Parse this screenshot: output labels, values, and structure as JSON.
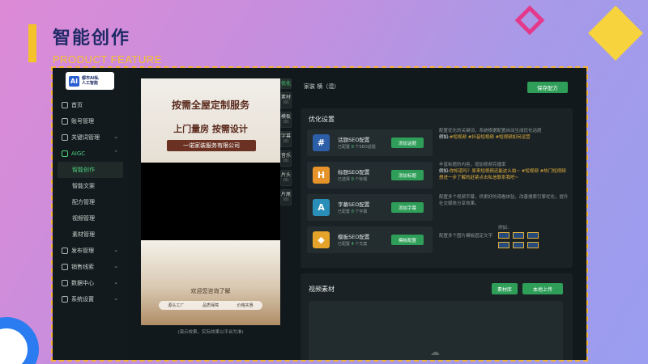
{
  "slide": {
    "title": "智能创作",
    "subtitle": "PRODUCT FEATURE"
  },
  "colors": {
    "accent_green": "#2e9e58",
    "accent_yellow": "#f4c22b",
    "title_blue": "#1f2a66",
    "app_bg": "#12191d"
  },
  "app": {
    "logo": {
      "line1": "都市AI私",
      "line2": "人工智能",
      "mark": "AI"
    },
    "sidebar": {
      "items": [
        {
          "label": "首页",
          "icon": "home-icon"
        },
        {
          "label": "账号管理",
          "icon": "account-icon"
        },
        {
          "label": "关键词管理",
          "icon": "gear-icon",
          "chev": "⌄"
        },
        {
          "label": "AIGC",
          "icon": "aigc-icon",
          "chev": "⌃"
        },
        {
          "label": "发布管理",
          "icon": "publish-icon",
          "chev": "⌄"
        },
        {
          "label": "销售线索",
          "icon": "leads-icon",
          "chev": "⌄"
        },
        {
          "label": "数据中心",
          "icon": "data-icon",
          "chev": "⌄"
        },
        {
          "label": "系统设置",
          "icon": "settings-icon",
          "chev": "⌄"
        }
      ],
      "aigc_sub": [
        "智能创作",
        "智能文案",
        "配方管理",
        "视频管理",
        "素材管理"
      ]
    },
    "phone": {
      "line1": "按需全屋定制服务",
      "line2": "上门量房 按需设计",
      "band": "一诺家装服务有限公司",
      "welcome": "欢迎您咨询了解",
      "tags": [
        "源头工厂",
        "品质保障",
        "价格实惠"
      ],
      "caption": "(演示效果，实际效果以平台为准)"
    },
    "vtabs": [
      {
        "label": "优化",
        "count": ""
      },
      {
        "label": "素材",
        "count": "(0)"
      },
      {
        "label": "模板",
        "count": "(0)"
      },
      {
        "label": "字幕",
        "count": "(0)"
      },
      {
        "label": "音乐",
        "count": "(0)"
      },
      {
        "label": "片头",
        "count": "(0)"
      },
      {
        "label": "片尾",
        "count": "(0)"
      }
    ],
    "top_label": "家装 横（混）",
    "save_button": "保存配方",
    "optimize": {
      "title": "优化设置",
      "items": [
        {
          "name": "话题SEO配置",
          "stat_prefix": "已配置",
          "stat_count": "0",
          "stat_suffix": "个SEO话题",
          "button": "添加话题",
          "icon": "hashtag-icon",
          "icon_glyph": "#",
          "icon_color": "#2d5ea8",
          "desc": "配置优化的关键词，系统根据配置自动生成优化话题",
          "example_label": "例如:",
          "example": "#短视频 #抖音短视频 #短视频如何运营"
        },
        {
          "name": "标题SEO配置",
          "stat_prefix": "已选择",
          "stat_count": "0",
          "stat_suffix": "个标题",
          "button": "添加标题",
          "icon": "title-h-icon",
          "icon_glyph": "H",
          "icon_color": "#e6932a",
          "desc": "丰富标题的内容，增加视频完播率",
          "example_label": "例如:",
          "example": "你知道吗？原来短视频还能这么拍~ #短视频 #热门短视频 想进一步了解的赶紧点击私信联系我吧~"
        },
        {
          "name": "字幕SEO配置",
          "stat_prefix": "已配置",
          "stat_count": "0",
          "stat_suffix": "个字幕",
          "button": "添加字幕",
          "icon": "subtitle-icon",
          "icon_glyph": "A",
          "icon_color": "#2a8fb8",
          "desc": "配置多个视频字幕，供更好的观看体验，改善搜索引擎优化，提升社交媒体分享效果。",
          "example_label": "",
          "example": ""
        },
        {
          "name": "模板SEO配置",
          "stat_prefix": "已配置",
          "stat_count": "4",
          "stat_suffix": "个文案",
          "button": "模板配置",
          "icon": "template-box-icon",
          "icon_glyph": "◆",
          "icon_color": "#e6a32a",
          "desc": "配置多个图片模板固定文字",
          "example_label": "例如:",
          "example": ""
        }
      ]
    },
    "video": {
      "title": "视频素材",
      "library_button": "素材库",
      "local_upload_button": "本地上传"
    }
  }
}
